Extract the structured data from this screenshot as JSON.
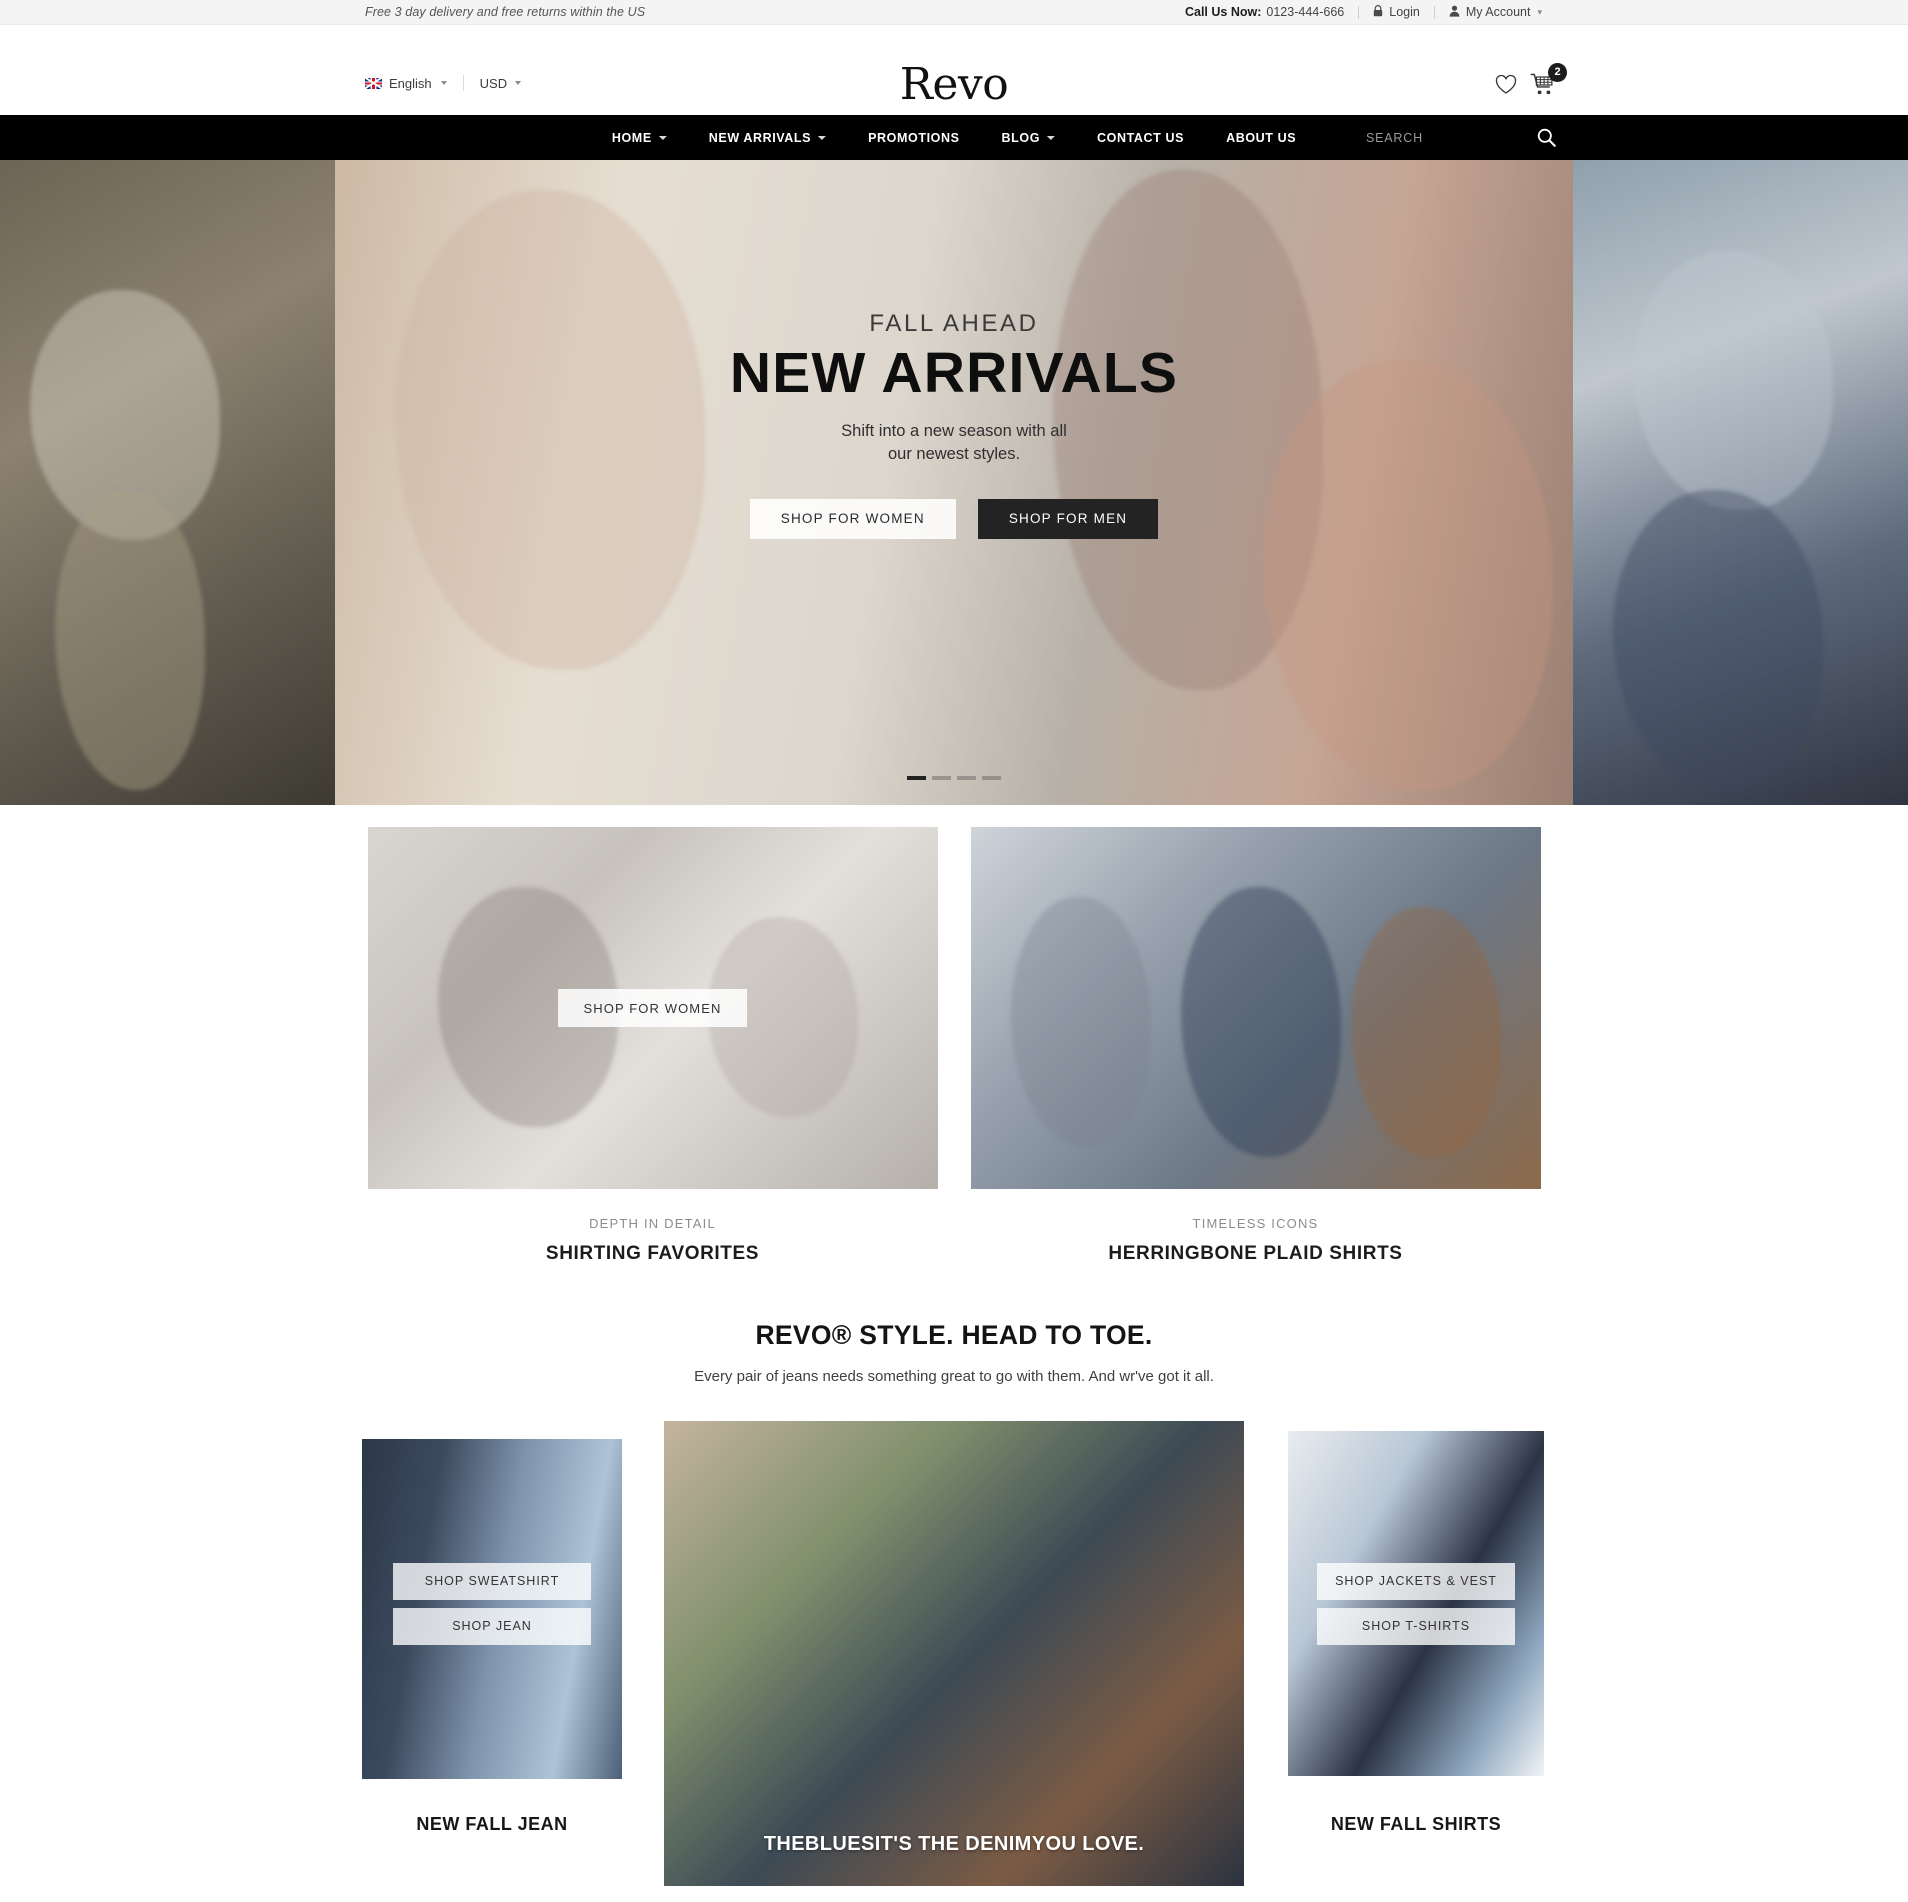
{
  "topbar": {
    "promo_text": "Free 3 day delivery and free returns within the US",
    "call_label": "Call Us Now:",
    "call_number": "0123-444-666",
    "login_label": "Login",
    "login_icon": "lock-icon",
    "account_label": "My Account",
    "account_icon": "user-icon",
    "caret_icon": "chevron-down-icon"
  },
  "header": {
    "language": "English",
    "language_flag": "uk-flag-icon",
    "currency": "USD",
    "logo_text": "Revo",
    "wishlist_icon": "heart-icon",
    "cart_icon": "shopping-cart-icon",
    "cart_count": "2"
  },
  "nav": {
    "items": [
      {
        "label": "HOME",
        "has_dropdown": true
      },
      {
        "label": "NEW ARRIVALS",
        "has_dropdown": true
      },
      {
        "label": "PROMOTIONS",
        "has_dropdown": false
      },
      {
        "label": "BLOG",
        "has_dropdown": true
      },
      {
        "label": "CONTACT US",
        "has_dropdown": false
      },
      {
        "label": "ABOUT US",
        "has_dropdown": false
      }
    ],
    "search_placeholder": "SEARCH",
    "search_icon": "search-icon"
  },
  "hero": {
    "kicker": "FALL AHEAD",
    "title": "NEW ARRIVALS",
    "subtitle_line1": "Shift into a new season with all",
    "subtitle_line2": "our newest styles.",
    "btn_women": "SHOP FOR WOMEN",
    "btn_men": "SHOP FOR MEN",
    "slide_count": 4,
    "active_slide": 1
  },
  "promos": [
    {
      "button": "SHOP FOR WOMEN",
      "kicker": "DEPTH IN DETAIL",
      "title": "SHIRTING FAVORITES"
    },
    {
      "button": "",
      "kicker": "TIMELESS ICONS",
      "title": "HERRINGBONE PLAID SHIRTS"
    }
  ],
  "style_section": {
    "title": "REVO® STYLE. HEAD TO TOE.",
    "subtitle": "Every pair of jeans needs something great to go with them. And wr've got it all."
  },
  "triptych": {
    "left": {
      "buttons": [
        "SHOP SWEATSHIRT",
        "SHOP JEAN"
      ],
      "label": "NEW FALL JEAN"
    },
    "center": {
      "caption": "THEBLUESIT'S THE DENIMYOU LOVE."
    },
    "right": {
      "buttons": [
        "SHOP JACKETS & VEST",
        "SHOP T-SHIRTS"
      ],
      "label": "NEW FALL SHIRTS"
    }
  },
  "colors": {
    "nav_bg": "#000000",
    "topbar_bg": "#f4f4f4",
    "dark_button": "#232323",
    "accent_text": "#8c8c8c"
  }
}
